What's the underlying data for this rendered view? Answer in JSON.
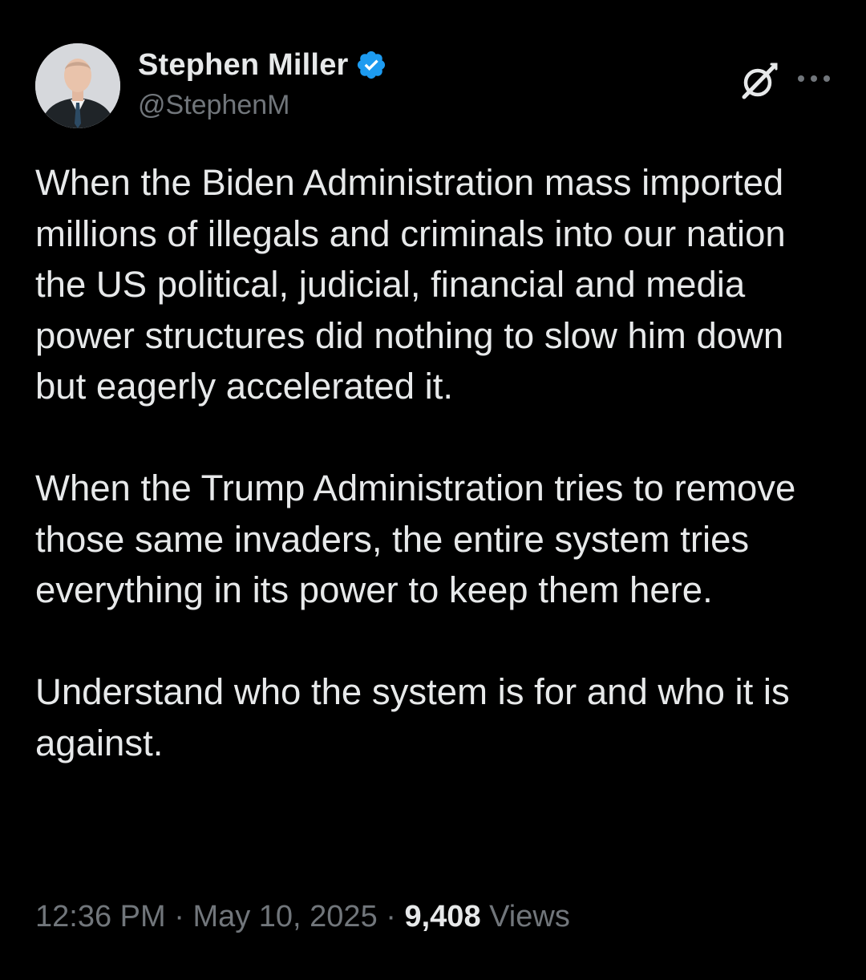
{
  "author": {
    "display_name": "Stephen Miller",
    "handle": "@StephenM",
    "verified": true,
    "verified_badge_color": "#1d9bf0"
  },
  "header_icons": {
    "grok_icon": "grok-icon",
    "more_icon": "more-options-icon"
  },
  "tweet": {
    "paragraphs": [
      "When the Biden Administration mass imported millions of illegals and criminals into our nation the US political, judicial, financial and media power structures did nothing to slow him down but eagerly accelerated it.",
      "When the Trump Administration tries to remove those same invaders, the entire system tries everything in its power to keep them here.",
      "Understand who the system is for and who it is against."
    ]
  },
  "meta": {
    "time": "12:36 PM",
    "separator": "·",
    "date": "May 10, 2025",
    "views_count": "9,408",
    "views_label": "Views"
  },
  "colors": {
    "background": "#000000",
    "primary_text": "#e7e9ea",
    "secondary_text": "#71767b",
    "accent": "#1d9bf0"
  }
}
